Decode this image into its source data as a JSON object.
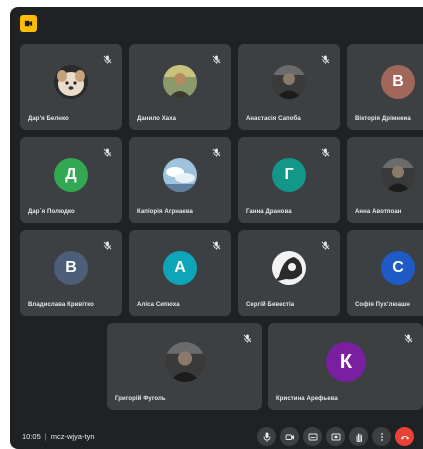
{
  "meeting": {
    "time": "10:05",
    "code": "mcz-wjya-tyn"
  },
  "participants": [
    {
      "name": "Дар'я Белнко",
      "avatar_type": "photo",
      "avatar_desc": "dog"
    },
    {
      "name": "Данило Хаха",
      "avatar_type": "photo",
      "avatar_desc": "person-outdoors"
    },
    {
      "name": "Анастасія Сапоба",
      "avatar_type": "photo",
      "avatar_desc": "person-dark"
    },
    {
      "name": "Вікторія Дрімнеиа",
      "avatar_type": "letter",
      "initial": "В",
      "color": "#a1675a"
    },
    {
      "name": "Дар`я Полюдко",
      "avatar_type": "letter",
      "initial": "Д",
      "color": "#33a852"
    },
    {
      "name": "Капіорія Агрнаева",
      "avatar_type": "photo",
      "avatar_desc": "sky"
    },
    {
      "name": "Ганна Дранова",
      "avatar_type": "letter",
      "initial": "Г",
      "color": "#129788"
    },
    {
      "name": "Анна Авотпоан",
      "avatar_type": "photo",
      "avatar_desc": "person-dark"
    },
    {
      "name": "Владислава Кривітко",
      "avatar_type": "letter",
      "initial": "В",
      "color": "#4b5f7a"
    },
    {
      "name": "Аліса Сипюха",
      "avatar_type": "letter",
      "initial": "А",
      "color": "#0ea5b8"
    },
    {
      "name": "Сергій Бевестіа",
      "avatar_type": "photo",
      "avatar_desc": "cartoon"
    },
    {
      "name": "Софія Пух'люашн",
      "avatar_type": "letter",
      "initial": "С",
      "color": "#1e5bc6"
    },
    {
      "name": "Григорій Фуголь",
      "avatar_type": "photo",
      "avatar_desc": "person-dark"
    },
    {
      "name": "Кристина Арефьева",
      "avatar_type": "letter",
      "initial": "К",
      "color": "#7b1fa2"
    }
  ],
  "controls": [
    {
      "name": "microphone",
      "icon": "mic-icon"
    },
    {
      "name": "camera",
      "icon": "camera-icon"
    },
    {
      "name": "captions",
      "icon": "captions-icon"
    },
    {
      "name": "present",
      "icon": "present-icon"
    },
    {
      "name": "raise-hand",
      "icon": "hand-icon"
    },
    {
      "name": "more-options",
      "icon": "more-vert-icon"
    },
    {
      "name": "leave-call",
      "icon": "phone-end-icon",
      "color": "#ea4335"
    }
  ],
  "theme": {
    "background": "#202124",
    "tile": "#3c4043",
    "accent": "#fbbc04"
  }
}
